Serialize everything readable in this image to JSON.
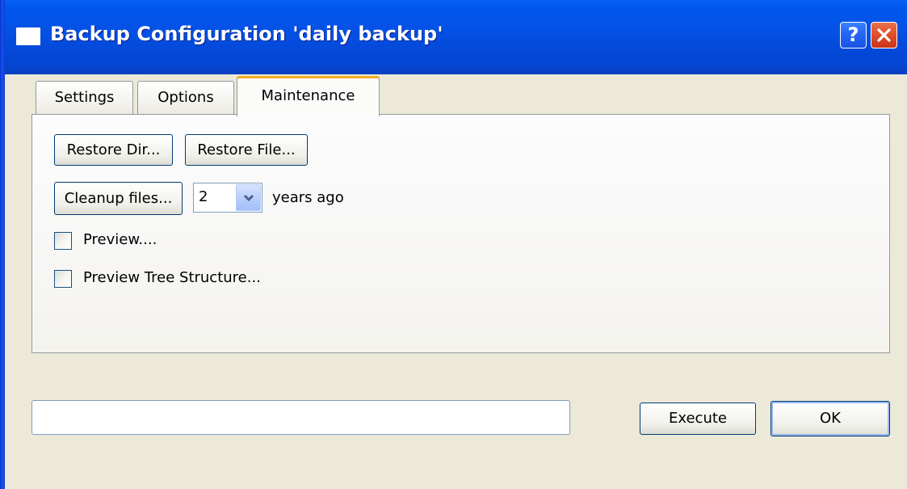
{
  "window": {
    "title": "Backup Configuration 'daily backup'",
    "help_glyph": "?",
    "colors": {
      "titlebar": "#0551e6",
      "face": "#ece9d8",
      "active_tab_accent": "#f4ab24",
      "close_button": "#e4502b"
    },
    "icons": [
      "window-icon",
      "help-icon",
      "close-icon",
      "chevron-down-icon"
    ]
  },
  "tabs": [
    {
      "label": "Settings",
      "selected": false
    },
    {
      "label": "Options",
      "selected": false
    },
    {
      "label": "Maintenance",
      "selected": true
    }
  ],
  "maintenance": {
    "restore_dir_label": "Restore Dir...",
    "restore_file_label": "Restore File...",
    "cleanup_label": "Cleanup files...",
    "cleanup_years_value": "2",
    "years_suffix": "years ago",
    "preview_label": "Preview....",
    "preview_checked": false,
    "preview_tree_label": "Preview Tree Structure...",
    "preview_tree_checked": false
  },
  "footer": {
    "status_value": "",
    "execute_label": "Execute",
    "ok_label": "OK"
  }
}
